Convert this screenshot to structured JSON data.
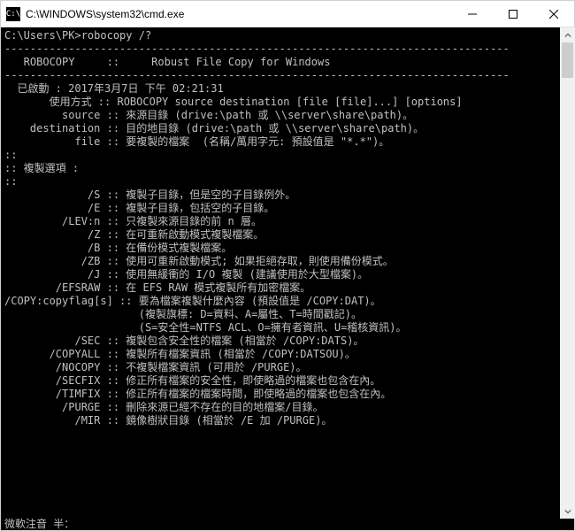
{
  "titlebar": {
    "icon_text": "C:\\",
    "title": "C:\\WINDOWS\\system32\\cmd.exe"
  },
  "prompt": {
    "cwd": "C:\\Users\\PK>",
    "command": "robocopy /?"
  },
  "header": {
    "dash_line": "-------------------------------------------------------------------------------",
    "title_line": "   ROBOCOPY     ::     Robust File Copy for Windows",
    "dash_line2": "-------------------------------------------------------------------------------"
  },
  "started": {
    "label": "  已啟動 : ",
    "value": "2017年3月7日 下午 02:21:31"
  },
  "usage": {
    "label": "       使用方式 :: ",
    "value": "ROBOCOPY source destination [file [file]...] [options]"
  },
  "params": [
    {
      "flag": "         source :: ",
      "desc": "來源目錄 (drive:\\path 或 \\\\server\\share\\path)。"
    },
    {
      "flag": "    destination :: ",
      "desc": "目的地目錄 (drive:\\path 或 \\\\server\\share\\path)。"
    },
    {
      "flag": "           file :: ",
      "desc": "要複製的檔案  (名稱/萬用字元: 預設值是 \"*.*\")。"
    }
  ],
  "section1": {
    "line": "::",
    "title": "複製選項 :"
  },
  "opts_block1": [
    {
      "flag": "             /S :: ",
      "desc": "複製子目錄，但是空的子目錄例外。"
    },
    {
      "flag": "             /E :: ",
      "desc": "複製子目錄，包括空的子目錄。"
    },
    {
      "flag": "         /LEV:n :: ",
      "desc": "只複製來源目錄的前 n 層。"
    }
  ],
  "opts_block2": [
    {
      "flag": "             /Z :: ",
      "desc": "在可重新啟動模式複製檔案。"
    },
    {
      "flag": "             /B :: ",
      "desc": "在備份模式複製檔案。"
    },
    {
      "flag": "            /ZB :: ",
      "desc": "使用可重新啟動模式; 如果拒絕存取，則使用備份模式。"
    },
    {
      "flag": "             /J :: ",
      "desc": "使用無緩衝的 I/O 複製 (建議使用於大型檔案)。"
    },
    {
      "flag": "        /EFSRAW :: ",
      "desc": "在 EFS RAW 模式複製所有加密檔案。"
    }
  ],
  "opts_block3": [
    {
      "flag": "/COPY:copyflag[s] :: ",
      "desc": "要為檔案複製什麼內容 (預設值是 /COPY:DAT)。"
    },
    {
      "flag": "                     ",
      "desc": "(複製旗標: D=資料、A=屬性、T=時間戳記)。"
    },
    {
      "flag": "                     ",
      "desc": "(S=安全性=NTFS ACL、O=擁有者資訊、U=稽核資訊)。"
    }
  ],
  "opts_block4": [
    {
      "flag": "           /SEC :: ",
      "desc": "複製包含安全性的檔案 (相當於 /COPY:DATS)。"
    },
    {
      "flag": "       /COPYALL :: ",
      "desc": "複製所有檔案資訊 (相當於 /COPY:DATSOU)。"
    },
    {
      "flag": "        /NOCOPY :: ",
      "desc": "不複製檔案資訊 (可用於 /PURGE)。"
    },
    {
      "flag": "        /SECFIX :: ",
      "desc": "修正所有檔案的安全性，即使略過的檔案也包含在內。"
    },
    {
      "flag": "        /TIMFIX :: ",
      "desc": "修正所有檔案的檔案時間，即使略過的檔案也包含在內。"
    }
  ],
  "opts_block5": [
    {
      "flag": "         /PURGE :: ",
      "desc": "刪除來源已經不存在的目的地檔案/目錄。"
    },
    {
      "flag": "           /MIR :: ",
      "desc": "鏡像樹狀目錄 (相當於 /E 加 /PURGE)。"
    }
  ],
  "ime_status": "微軟注音 半："
}
